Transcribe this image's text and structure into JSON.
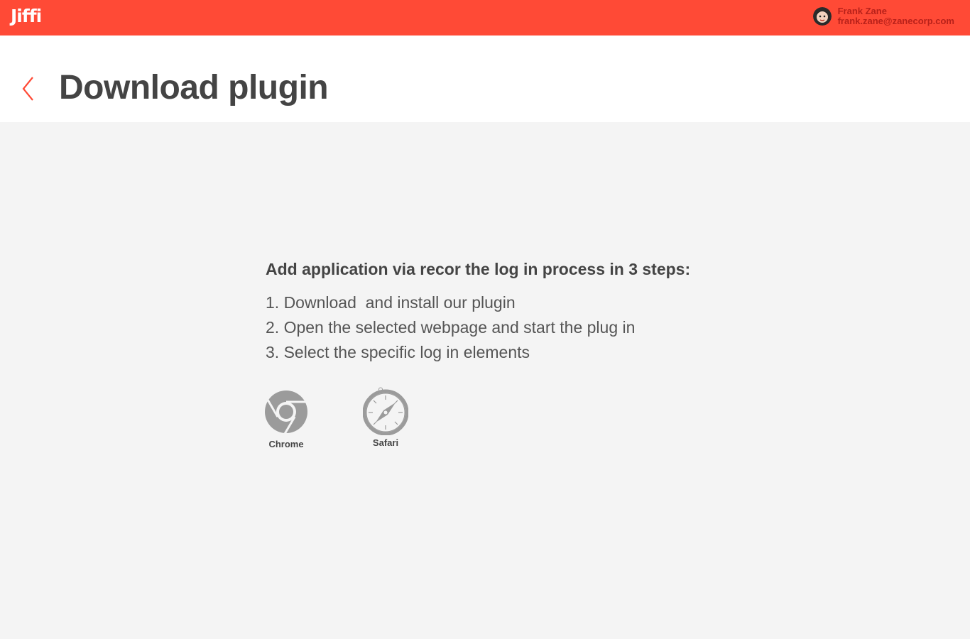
{
  "app": {
    "logo": "Jiffi"
  },
  "user": {
    "name": "Frank Zane",
    "email": "frank.zane@zanecorp.com"
  },
  "header": {
    "title": "Download plugin"
  },
  "main": {
    "intro": "Add application via recor the log in process in 3 steps:",
    "steps": [
      "1. Download  and install our plugin",
      "2. Open the selected webpage and start the plug in",
      "3. Select the specific log in elements"
    ],
    "browsers": [
      {
        "label": "Chrome",
        "icon": "chrome-icon"
      },
      {
        "label": "Safari",
        "icon": "safari-icon"
      }
    ]
  },
  "colors": {
    "accent": "#ff4a36",
    "background": "#f4f4f4",
    "icon_gray": "#9b9b9b"
  }
}
